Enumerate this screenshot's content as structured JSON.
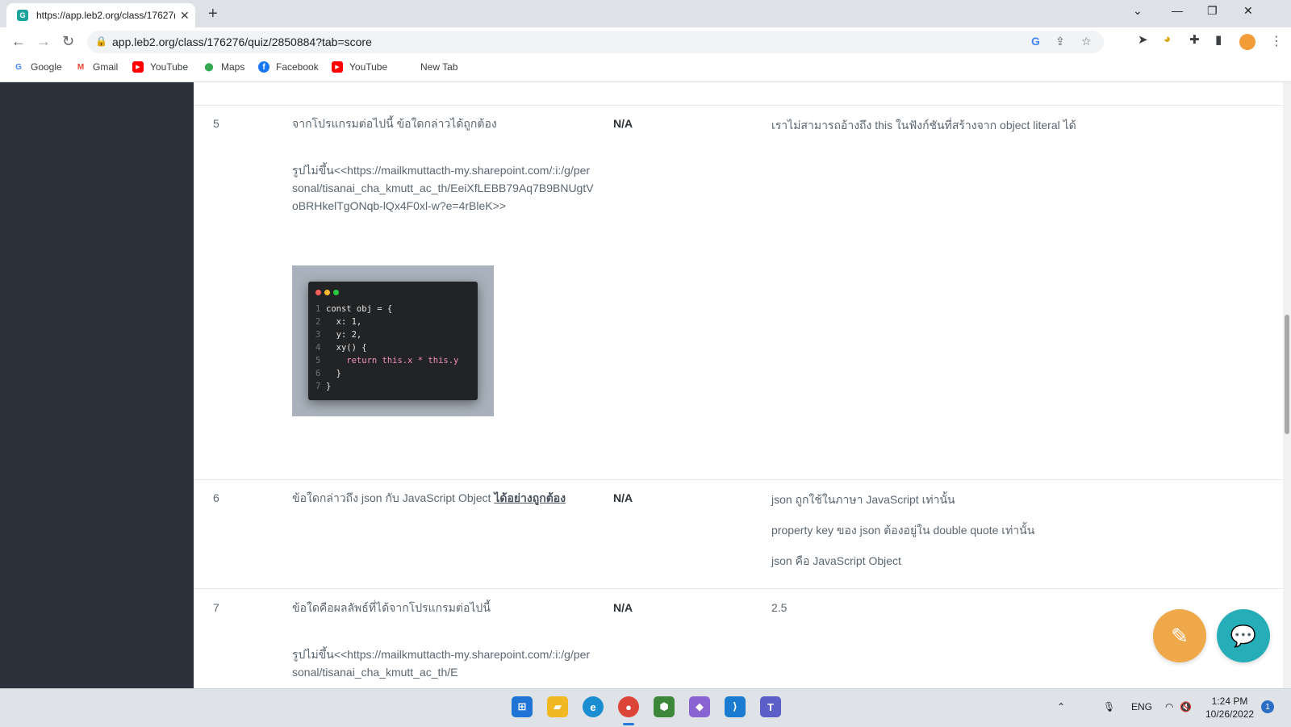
{
  "browser": {
    "tab_title": "https://app.leb2.org/class/17627(",
    "favicon_letter": "G",
    "url": "app.leb2.org/class/176276/quiz/2850884?tab=score",
    "bookmarks": [
      {
        "label": "Google",
        "icon": "google-icon",
        "color": "#4285f4"
      },
      {
        "label": "Gmail",
        "icon": "gmail-icon",
        "color": "#ea4335"
      },
      {
        "label": "YouTube",
        "icon": "youtube-icon",
        "color": "#ff0000"
      },
      {
        "label": "Maps",
        "icon": "maps-icon",
        "color": "#34a853"
      },
      {
        "label": "Facebook",
        "icon": "facebook-icon",
        "color": "#1877f2"
      },
      {
        "label": "YouTube",
        "icon": "youtube-icon",
        "color": "#ff0000"
      },
      {
        "label": "New Tab",
        "icon": "none",
        "color": ""
      }
    ]
  },
  "rows": [
    {
      "number": "5",
      "question": "จากโปรแกรมต่อไปนี้ ข้อใดกล่าวได้ถูกต้อง",
      "image_text": "รูปไม่ขึ้น<<https://mailkmuttacth-my.sharepoint.com/:i:/g/personal/tisanai_cha_kmutt_ac_th/EeiXfLEBB79Aq7B9BNUgtVoBRHkelTgONqb-lQx4F0xl-w?e=4rBleK>>",
      "score": "N/A",
      "answers": [
        "เราไม่สามารถอ้างถึง this ในฟังก์ชันที่สร้างจาก object literal ได้"
      ],
      "code_lines": [
        {
          "n": "1",
          "text": "const obj = {"
        },
        {
          "n": "2",
          "text": "  x: 1,"
        },
        {
          "n": "3",
          "text": "  y: 2,"
        },
        {
          "n": "4",
          "text": "  xy() {"
        },
        {
          "n": "5",
          "text": "    return this.x * this.y"
        },
        {
          "n": "6",
          "text": "  }"
        },
        {
          "n": "7",
          "text": "}"
        }
      ]
    },
    {
      "number": "6",
      "question_prefix": "ข้อใดกล่าวถึง json กับ JavaScript Object",
      "question_emphasis": "ได้อย่างถูกต้อง",
      "score": "N/A",
      "answers": [
        "json ถูกใช้ในภาษา JavaScript เท่านั้น",
        "property key ของ json ต้องอยู่ใน double quote เท่านั้น",
        "json คือ JavaScript Object"
      ]
    },
    {
      "number": "7",
      "question": "ข้อใดคือผลลัพธ์ที่ได้จากโปรแกรมต่อไปนี้",
      "image_text": "รูปไม่ขึ้น<<https://mailkmuttacth-my.sharepoint.com/:i:/g/personal/tisanai_cha_kmutt_ac_th/E",
      "score": "N/A",
      "answers": [
        "2.5"
      ]
    }
  ],
  "fabs": {
    "edit_color": "#f0a94a",
    "chat_color": "#26aeb8"
  },
  "taskbar": {
    "language": "ENG",
    "time": "1:24 PM",
    "date": "10/26/2022",
    "notification_count": "1"
  }
}
